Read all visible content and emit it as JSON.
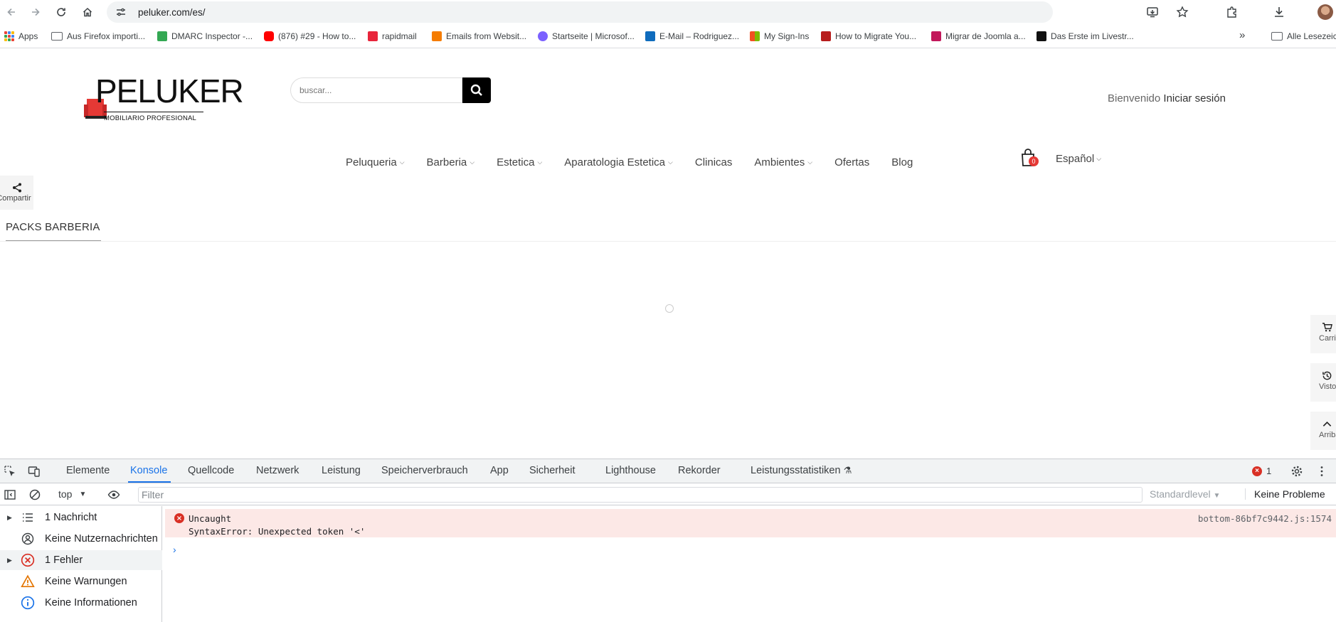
{
  "browser": {
    "url": "peluker.com/es/",
    "bookmarks": [
      {
        "label": "Apps"
      },
      {
        "label": "Aus Firefox importi..."
      },
      {
        "label": "DMARC Inspector -..."
      },
      {
        "label": "(876) #29 - How to..."
      },
      {
        "label": "rapidmail"
      },
      {
        "label": "Emails from Websit..."
      },
      {
        "label": "Startseite | Microsof..."
      },
      {
        "label": "E-Mail – Rodriguez..."
      },
      {
        "label": "My Sign-Ins"
      },
      {
        "label": "How to Migrate You..."
      },
      {
        "label": "Migrar de Joomla a..."
      },
      {
        "label": "Das Erste im Livestr..."
      }
    ],
    "more_bookmarks": "»",
    "other_bookmarks": "Alle Lesezeic"
  },
  "site": {
    "logo_text": "PELUKER",
    "logo_sub": "MOBILIARIO PROFESIONAL",
    "search_placeholder": "buscar...",
    "welcome": "Bienvenido",
    "login": "Iniciar sesión",
    "nav": [
      {
        "label": "Peluqueria",
        "chevron": true
      },
      {
        "label": "Barberia",
        "chevron": true
      },
      {
        "label": "Estetica",
        "chevron": true
      },
      {
        "label": "Aparatologia Estetica",
        "chevron": true
      },
      {
        "label": "Clinicas",
        "chevron": false
      },
      {
        "label": "Ambientes",
        "chevron": true
      },
      {
        "label": "Ofertas",
        "chevron": false
      },
      {
        "label": "Blog",
        "chevron": false
      }
    ],
    "cart_count": "0",
    "language": "Español",
    "share_label": "Compartir",
    "breadcrumb": "PACKS BARBERIA",
    "side_tools": [
      {
        "label": "Carrito",
        "icon": "cart-icon"
      },
      {
        "label": "Vistos",
        "icon": "history-icon"
      },
      {
        "label": "Arriba",
        "icon": "chevron-up-icon"
      }
    ]
  },
  "devtools": {
    "tabs": [
      "Elemente",
      "Konsole",
      "Quellcode",
      "Netzwerk",
      "Leistung",
      "Speicherverbrauch",
      "App",
      "Sicherheit",
      "Lighthouse",
      "Rekorder",
      "Leistungsstatistiken"
    ],
    "active_tab": "Konsole",
    "error_count": "1",
    "context": "top",
    "filter_placeholder": "Filter",
    "levels": "Standardlevel",
    "issues": "Keine Probleme",
    "sidebar": [
      {
        "label": "1 Nachricht",
        "icon": "list-icon",
        "expandable": true
      },
      {
        "label": "Keine Nutzernachrichten",
        "icon": "user-icon",
        "expandable": false
      },
      {
        "label": "1 Fehler",
        "icon": "error-icon",
        "expandable": true
      },
      {
        "label": "Keine Warnungen",
        "icon": "warning-icon",
        "expandable": false
      },
      {
        "label": "Keine Informationen",
        "icon": "info-icon",
        "expandable": false
      }
    ],
    "message": {
      "line1": "Uncaught",
      "line2": "SyntaxError: Unexpected token '<'",
      "source": "bottom-86bf7c9442.js:1574"
    },
    "prompt": "›"
  },
  "colors": {
    "accent": "#1a73e8",
    "error": "#d93025",
    "error_bg": "#fce8e6",
    "cart_badge": "#e53935"
  }
}
